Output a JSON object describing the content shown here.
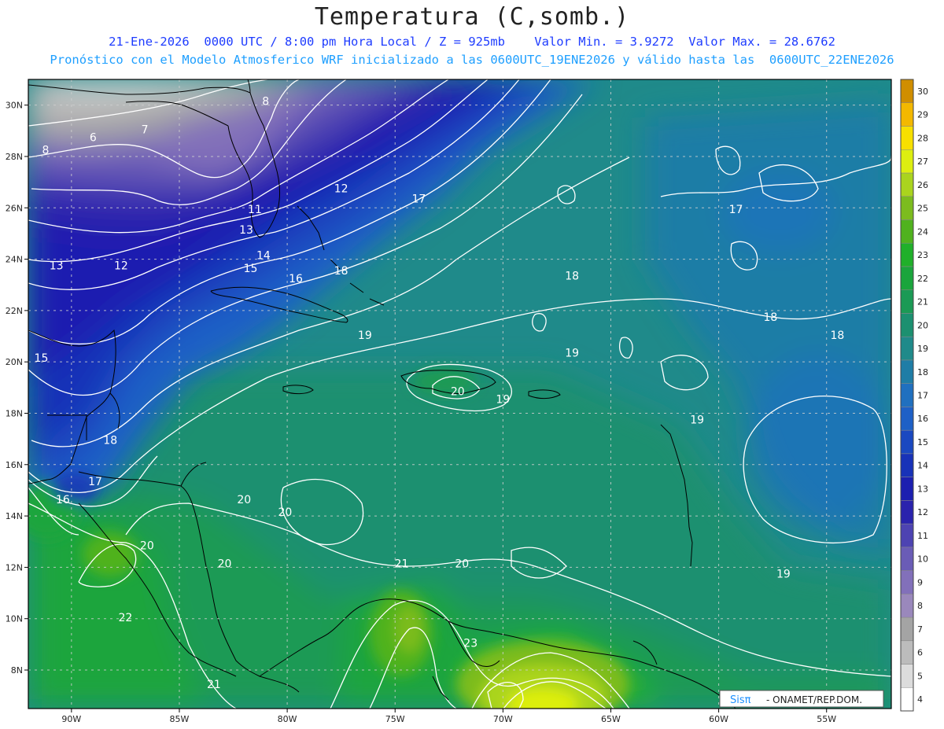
{
  "title": "Temperatura (C,somb.)",
  "subtitle_line1": "21-Ene-2026  0000 UTC / 8:00 pm Hora Local / Z = 925mb    Valor Min. = 3.9272  Valor Max. = 28.6762",
  "subtitle_line2": "Pronóstico con el Modelo Atmosferico WRF inicializado a las 0600UTC_19ENE2026 y válido hasta las  0600UTC_22ENE2026",
  "map": {
    "lon_range": [
      -92,
      -52
    ],
    "lat_range": [
      6.5,
      31
    ],
    "lon_ticks": [
      "90W",
      "85W",
      "80W",
      "75W",
      "70W",
      "65W",
      "60W",
      "55W"
    ],
    "lat_ticks": [
      "30N",
      "28N",
      "26N",
      "24N",
      "22N",
      "20N",
      "18N",
      "16N",
      "14N",
      "12N",
      "10N",
      "8N"
    ],
    "contour_labels": [
      {
        "t": "6",
        "lon": -89.0,
        "lat": 28.6
      },
      {
        "t": "7",
        "lon": -86.6,
        "lat": 28.9
      },
      {
        "t": "8",
        "lon": -91.2,
        "lat": 28.1
      },
      {
        "t": "8",
        "lon": -81.0,
        "lat": 30.0
      },
      {
        "t": "11",
        "lon": -81.5,
        "lat": 25.8
      },
      {
        "t": "12",
        "lon": -77.5,
        "lat": 26.6
      },
      {
        "t": "12",
        "lon": -87.7,
        "lat": 23.6
      },
      {
        "t": "13",
        "lon": -90.7,
        "lat": 23.6
      },
      {
        "t": "13",
        "lon": -81.9,
        "lat": 25.0
      },
      {
        "t": "14",
        "lon": -81.1,
        "lat": 24.0
      },
      {
        "t": "15",
        "lon": -81.7,
        "lat": 23.5
      },
      {
        "t": "16",
        "lon": -79.6,
        "lat": 23.1
      },
      {
        "t": "17",
        "lon": -73.9,
        "lat": 26.2
      },
      {
        "t": "17",
        "lon": -59.2,
        "lat": 25.8
      },
      {
        "t": "18",
        "lon": -77.5,
        "lat": 23.4
      },
      {
        "t": "18",
        "lon": -66.8,
        "lat": 23.2
      },
      {
        "t": "18",
        "lon": -57.6,
        "lat": 21.6
      },
      {
        "t": "18",
        "lon": -54.5,
        "lat": 20.9
      },
      {
        "t": "18",
        "lon": -88.2,
        "lat": 16.8
      },
      {
        "t": "19",
        "lon": -76.4,
        "lat": 20.9
      },
      {
        "t": "19",
        "lon": -66.8,
        "lat": 20.2
      },
      {
        "t": "19",
        "lon": -70.0,
        "lat": 18.4
      },
      {
        "t": "19",
        "lon": -61.0,
        "lat": 17.6
      },
      {
        "t": "19",
        "lon": -57.0,
        "lat": 11.6
      },
      {
        "t": "20",
        "lon": -72.1,
        "lat": 18.7
      },
      {
        "t": "20",
        "lon": -82.0,
        "lat": 14.5
      },
      {
        "t": "20",
        "lon": -80.1,
        "lat": 14.0
      },
      {
        "t": "20",
        "lon": -86.5,
        "lat": 12.7
      },
      {
        "t": "20",
        "lon": -82.9,
        "lat": 12.0
      },
      {
        "t": "20",
        "lon": -71.9,
        "lat": 12.0
      },
      {
        "t": "21",
        "lon": -74.7,
        "lat": 12.0
      },
      {
        "t": "22",
        "lon": -87.5,
        "lat": 9.9
      },
      {
        "t": "21",
        "lon": -83.4,
        "lat": 7.3
      },
      {
        "t": "23",
        "lon": -71.5,
        "lat": 8.9
      },
      {
        "t": "17",
        "lon": -88.9,
        "lat": 15.2
      },
      {
        "t": "16",
        "lon": -90.4,
        "lat": 14.5
      },
      {
        "t": "15",
        "lon": -91.4,
        "lat": 20.0
      }
    ]
  },
  "legend": {
    "levels": [
      "4",
      "5",
      "6",
      "7",
      "8",
      "9",
      "10",
      "11",
      "12",
      "13",
      "14",
      "15",
      "16",
      "17",
      "18",
      "19",
      "20",
      "21",
      "22",
      "23",
      "24",
      "25",
      "26",
      "27",
      "28",
      "29",
      "30"
    ],
    "colors": [
      "#ffffff",
      "#dcdcdc",
      "#bcbcbc",
      "#a4a4a4",
      "#9a88bc",
      "#8270ba",
      "#6a5cb6",
      "#4d43b2",
      "#2a23ad",
      "#1c1fb0",
      "#1832b8",
      "#1a48c0",
      "#1e60c6",
      "#2070bf",
      "#1f7da6",
      "#1f8a8a",
      "#1c9070",
      "#1b9a55",
      "#1aa53c",
      "#20b02a",
      "#50b21e",
      "#7cbc1e",
      "#aad41e",
      "#ddee10",
      "#f7e000",
      "#f3b800",
      "#d08e00"
    ]
  },
  "credit": {
    "brand": "Sisπ",
    "suffix": "- ONAMET/REP.DOM."
  }
}
